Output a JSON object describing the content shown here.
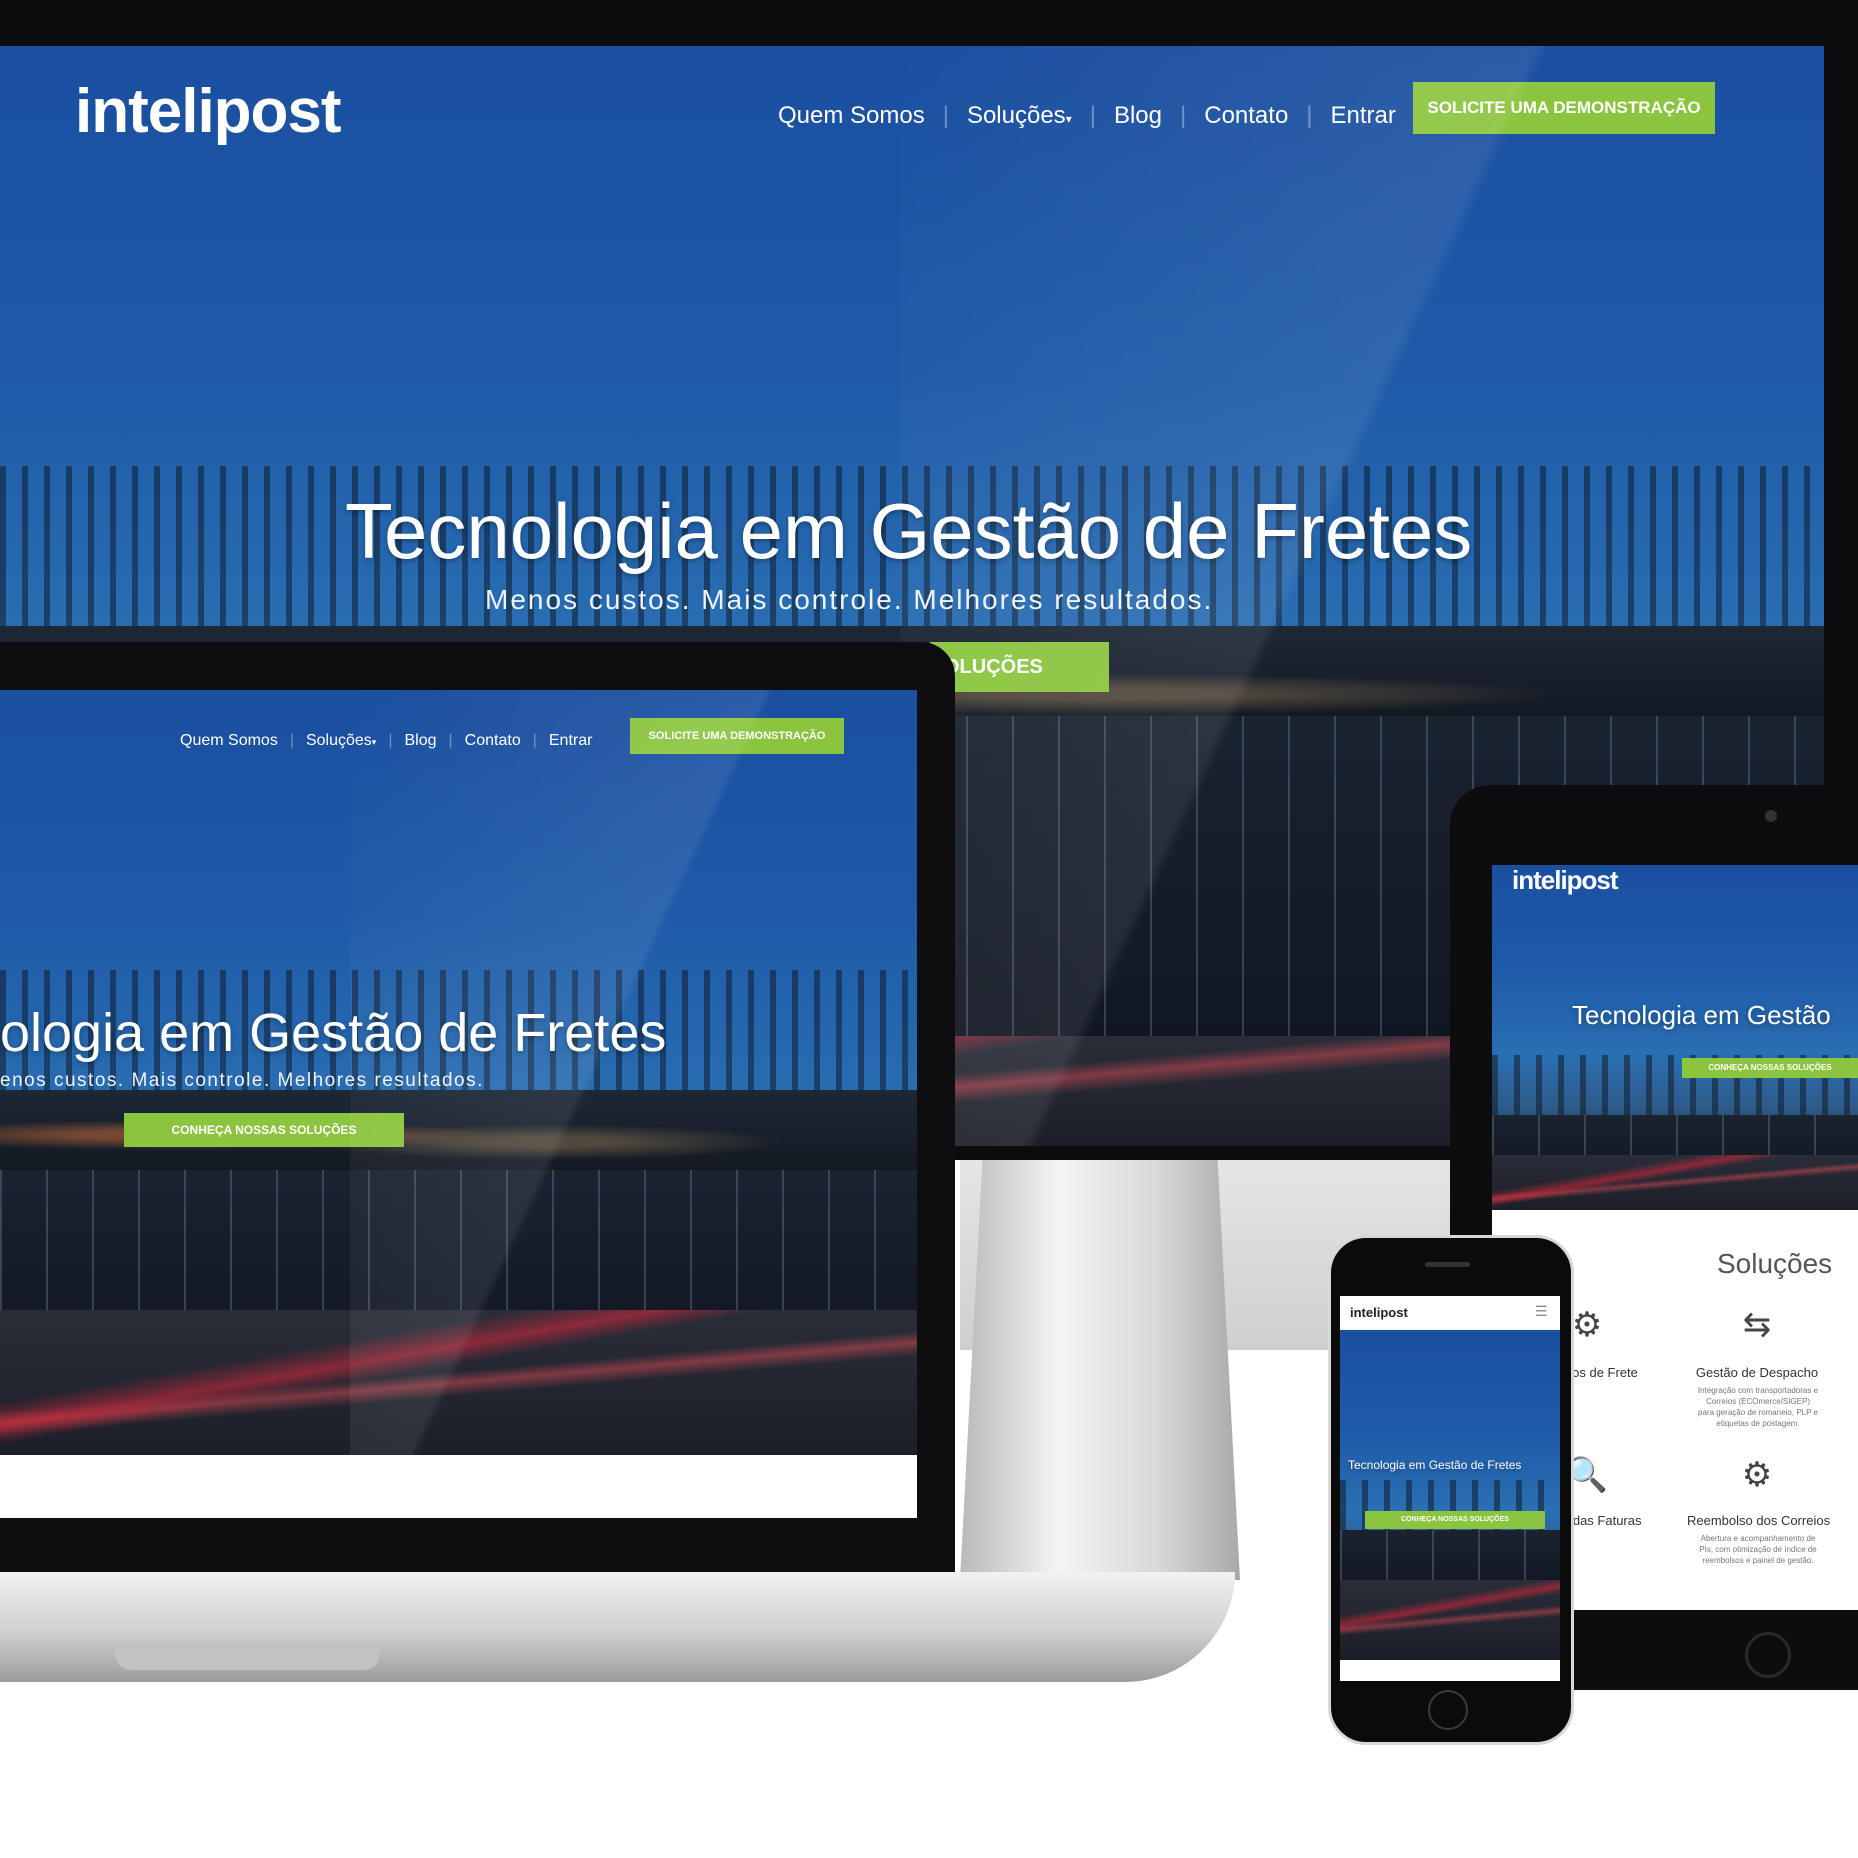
{
  "brand": {
    "logo": "intelipost",
    "accent": "#8bc53f",
    "sky": "#1e5aa8"
  },
  "nav": {
    "items": [
      "Quem Somos",
      "Soluções",
      "Blog",
      "Contato",
      "Entrar"
    ],
    "dropdown_caret": "▾",
    "cta": "SOLICITE UMA DEMONSTRAÇÃO"
  },
  "hero": {
    "title": "Tecnologia em Gestão de Fretes",
    "subtitle": "Menos custos. Mais controle. Melhores resultados.",
    "cta": "CONHEÇA NOSSAS SOLUÇÕES",
    "monitor_cta_visible": "OLUÇÕES",
    "laptop_title_visible": "ologia em Gestão de Fretes",
    "laptop_subtitle_visible": "enos custos. Mais controle. Melhores resultados.",
    "tablet_title_visible": "Tecnologia em Gestão"
  },
  "solutions": {
    "heading": "Soluções",
    "items": [
      {
        "title": "Gestão de Despacho",
        "icon": "dispatch-icon",
        "text": "Integração com transportadoras e Correios (ECOmerce/SIGEP) para geração de romaneio, PLP e etiquetas de postagem."
      },
      {
        "title": "Reembolso dos Correios",
        "icon": "gears-icon",
        "text": "Abertura e acompanhamento de PIs, com otimização de índice de reembolsos e painel de gestão."
      }
    ],
    "cut_items": [
      {
        "title": "ulos de Frete",
        "icon": "shipping-calc-icon"
      },
      {
        "title": "a das Faturas",
        "icon": "invoice-audit-icon"
      }
    ]
  },
  "phone": {
    "logo": "intelipost",
    "menu_icon": "☰",
    "title": "Tecnologia em Gestão de Fretes",
    "cta": "CONHEÇA NOSSAS SOLUÇÕES"
  }
}
